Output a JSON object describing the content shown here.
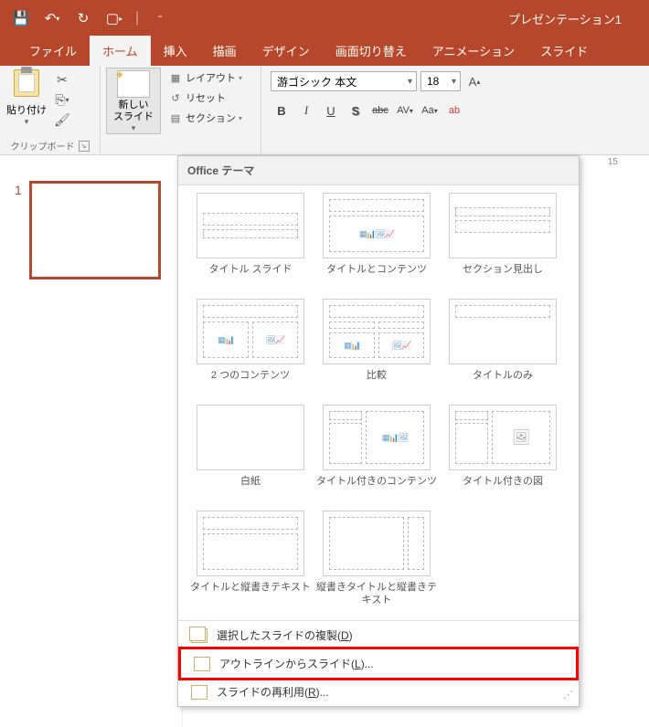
{
  "title": "プレゼンテーション1",
  "tabs": [
    "ファイル",
    "ホーム",
    "挿入",
    "描画",
    "デザイン",
    "画面切り替え",
    "アニメーション",
    "スライド"
  ],
  "active_tab_index": 1,
  "clipboard": {
    "paste": "貼り付け",
    "group_label": "クリップボード"
  },
  "slides_group": {
    "new_slide": "新しい\nスライド",
    "layout": "レイアウト",
    "reset": "リセット",
    "section": "セクション"
  },
  "font": {
    "name": "游ゴシック 本文",
    "size": "18"
  },
  "thumbnail_number": "1",
  "gallery": {
    "header": "Office テーマ",
    "layouts": [
      "タイトル スライド",
      "タイトルとコンテンツ",
      "セクション見出し",
      "2 つのコンテンツ",
      "比較",
      "タイトルのみ",
      "白紙",
      "タイトル付きのコンテンツ",
      "タイトル付きの図",
      "タイトルと縦書きテキスト",
      "縦書きタイトルと縦書きテキスト"
    ],
    "menu": {
      "duplicate": "選択したスライドの複製(",
      "duplicate_key": "D",
      "outline": "アウトラインからスライド(",
      "outline_key": "L",
      "reuse": "スライドの再利用(",
      "reuse_key": "R",
      "suffix": ")...",
      "suffix_plain": ")"
    }
  },
  "ruler_mark": "15"
}
